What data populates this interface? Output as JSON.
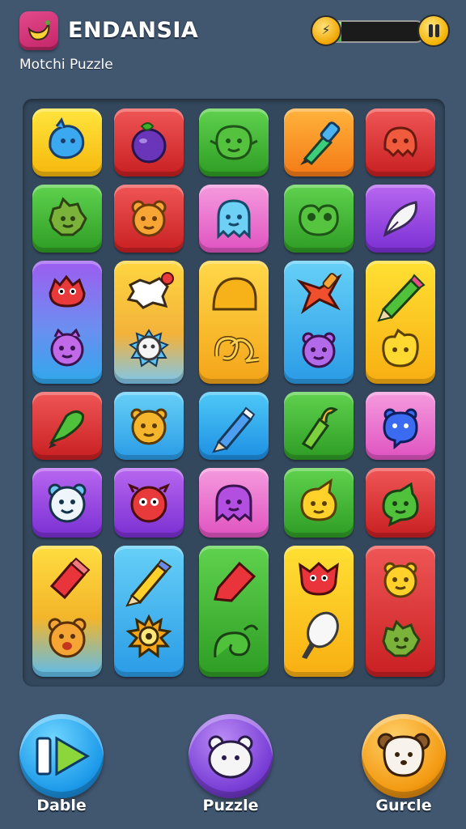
{
  "header": {
    "title": "ENDANSIA",
    "subtitle": "Motchi Puzzle",
    "energy_icon_text": "⚡",
    "energy_level": 0.15,
    "accent_color": "#f3b200"
  },
  "board": {
    "rows": 6,
    "columns": 5,
    "tiles": [
      {
        "color": "yellow",
        "icon": "blue-blob-icon"
      },
      {
        "color": "red",
        "icon": "purple-berry-icon"
      },
      {
        "color": "green",
        "icon": "green-blob-icon"
      },
      {
        "color": "orange",
        "icon": "paint-brush-icon"
      },
      {
        "color": "red",
        "icon": "red-blob-icon"
      },
      {
        "color": "green",
        "icon": "spiky-blob-icon"
      },
      {
        "color": "red",
        "icon": "bear-face-icon"
      },
      {
        "color": "pink",
        "icon": "ghost-icon"
      },
      {
        "color": "green",
        "icon": "frog-icon"
      },
      {
        "color": "purple",
        "icon": "feather-icon"
      },
      {
        "color": "violet-blue",
        "icon": "red-monster-icon",
        "icon2": "purple-monster-icon"
      },
      {
        "color": "yellow-blue",
        "icon": "speech-bubble-icon",
        "icon2": "white-sunflower-icon"
      },
      {
        "color": "yellow-gold",
        "icon": "helmet-icon",
        "icon2": "knot-icon"
      },
      {
        "color": "sky-blue",
        "icon": "shuriken-icon",
        "icon2": "purple-bear-icon"
      },
      {
        "color": "yellow-orange",
        "icon": "pencil-icon",
        "icon2": "yellow-blob-icon"
      },
      {
        "color": "red",
        "icon": "green-pen-icon"
      },
      {
        "color": "sky-blue",
        "icon": "orange-face-icon"
      },
      {
        "color": "blue",
        "icon": "pencil-icon"
      },
      {
        "color": "green",
        "icon": "leaf-brush-icon"
      },
      {
        "color": "pink",
        "icon": "blue-monster-icon"
      },
      {
        "color": "purple",
        "icon": "white-bear-icon"
      },
      {
        "color": "purple",
        "icon": "red-monster-icon"
      },
      {
        "color": "pink",
        "icon": "purple-ghost-icon"
      },
      {
        "color": "green",
        "icon": "yellow-bird-icon"
      },
      {
        "color": "red",
        "icon": "green-monster-icon"
      },
      {
        "color": "yellow-blue",
        "icon": "red-marker-icon",
        "icon2": "lion-face-icon"
      },
      {
        "color": "sky-blue",
        "icon": "yellow-pencil-icon",
        "icon2": "sun-eye-icon"
      },
      {
        "color": "green",
        "icon": "red-marker-icon",
        "icon2": "green-swirl-icon"
      },
      {
        "color": "yellow-orange",
        "icon": "red-monster-icon",
        "icon2": "white-brush-icon"
      },
      {
        "color": "red",
        "icon": "yellow-bear-icon",
        "icon2": "green-monster-icon"
      }
    ]
  },
  "bottom_nav": {
    "items": [
      {
        "label": "Dable",
        "icon": "play-icon",
        "color": "#1e9bea"
      },
      {
        "label": "Puzzle",
        "icon": "sheep-icon",
        "color": "#7a3fd6"
      },
      {
        "label": "Gurcle",
        "icon": "puppy-icon",
        "color": "#f39a12"
      }
    ]
  }
}
